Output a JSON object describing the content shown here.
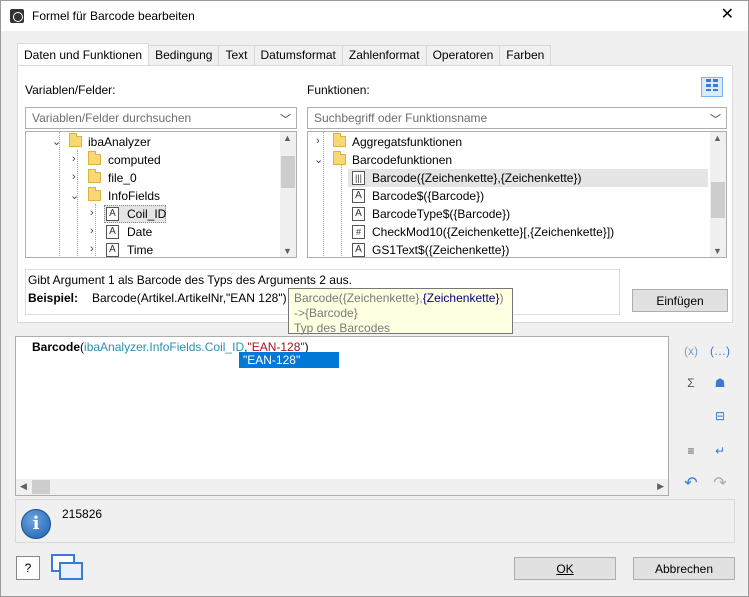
{
  "window": {
    "title": "Formel für Barcode bearbeiten",
    "close_glyph": "✕"
  },
  "tabs": [
    "Daten und Funktionen",
    "Bedingung",
    "Text",
    "Datumsformat",
    "Zahlenformat",
    "Operatoren",
    "Farben"
  ],
  "active_tab": "Daten und Funktionen",
  "variables": {
    "label": "Variablen/Felder:",
    "search_placeholder": "Variablen/Felder durchsuchen",
    "tree": [
      {
        "label": "ibaAnalyzer",
        "type": "folder",
        "expanded": true
      },
      {
        "label": "computed",
        "type": "folder",
        "expanded": false
      },
      {
        "label": "file_0",
        "type": "folder",
        "expanded": false
      },
      {
        "label": "InfoFields",
        "type": "folder",
        "expanded": true
      },
      {
        "label": "Coil_ID",
        "type": "text-field",
        "selected": true
      },
      {
        "label": "Date",
        "type": "text-field"
      },
      {
        "label": "Time",
        "type": "text-field"
      }
    ]
  },
  "functions": {
    "label": "Funktionen:",
    "search_placeholder": "Suchbegriff oder Funktionsname",
    "tree": [
      {
        "label": "Aggregatsfunktionen",
        "type": "folder",
        "expanded": false
      },
      {
        "label": "Barcodefunktionen",
        "type": "folder",
        "expanded": true
      },
      {
        "label": "Barcode({Zeichenkette},{Zeichenkette})",
        "type": "barcode",
        "selected": true
      },
      {
        "label": "Barcode$({Barcode})",
        "type": "text-field"
      },
      {
        "label": "BarcodeType$({Barcode})",
        "type": "text-field"
      },
      {
        "label": "CheckMod10({Zeichenkette}[,{Zeichenkette}])",
        "type": "checksum"
      },
      {
        "label": "GS1Text$({Zeichenkette})",
        "type": "text-field"
      }
    ]
  },
  "description": {
    "text": "Gibt Argument 1 als Barcode des Typs des Arguments 2 aus.",
    "example_label": "Beispiel:",
    "example_value": "Barcode(Artikel.ArtikelNr,\"EAN 128\")"
  },
  "tooltip": {
    "signature_prefix": "Barcode({Zeichenkette},",
    "signature_current": "{Zeichenkette}",
    "signature_suffix": ")",
    "returns": "->{Barcode}",
    "param_description": "Typ des Barcodes"
  },
  "insert_button": "Einfügen",
  "editor": {
    "func": "Barcode",
    "open": "(",
    "arg1": "ibaAnalyzer.InfoFields.Coil_ID",
    "comma": ",",
    "arg2": "\"EAN-128\"",
    "close": ")",
    "autocomplete_item": "\"EAN-128\""
  },
  "status": {
    "value": "215826"
  },
  "buttons": {
    "ok": "OK",
    "cancel": "Abbrechen",
    "help": "?"
  },
  "icons": [
    "grid-view-icon",
    "variable-braces-icon",
    "function-braces-icon",
    "sum-icon",
    "users-icon",
    "field-tree-icon",
    "indent-icon",
    "wrap-icon",
    "undo-icon",
    "redo-icon",
    "info-icon",
    "help-icon",
    "window-switch-icon"
  ],
  "colors": {
    "accent": "#0078d7",
    "variable": "#2b91af",
    "string": "#a31515",
    "tooltip_bg": "#ffffe1"
  }
}
